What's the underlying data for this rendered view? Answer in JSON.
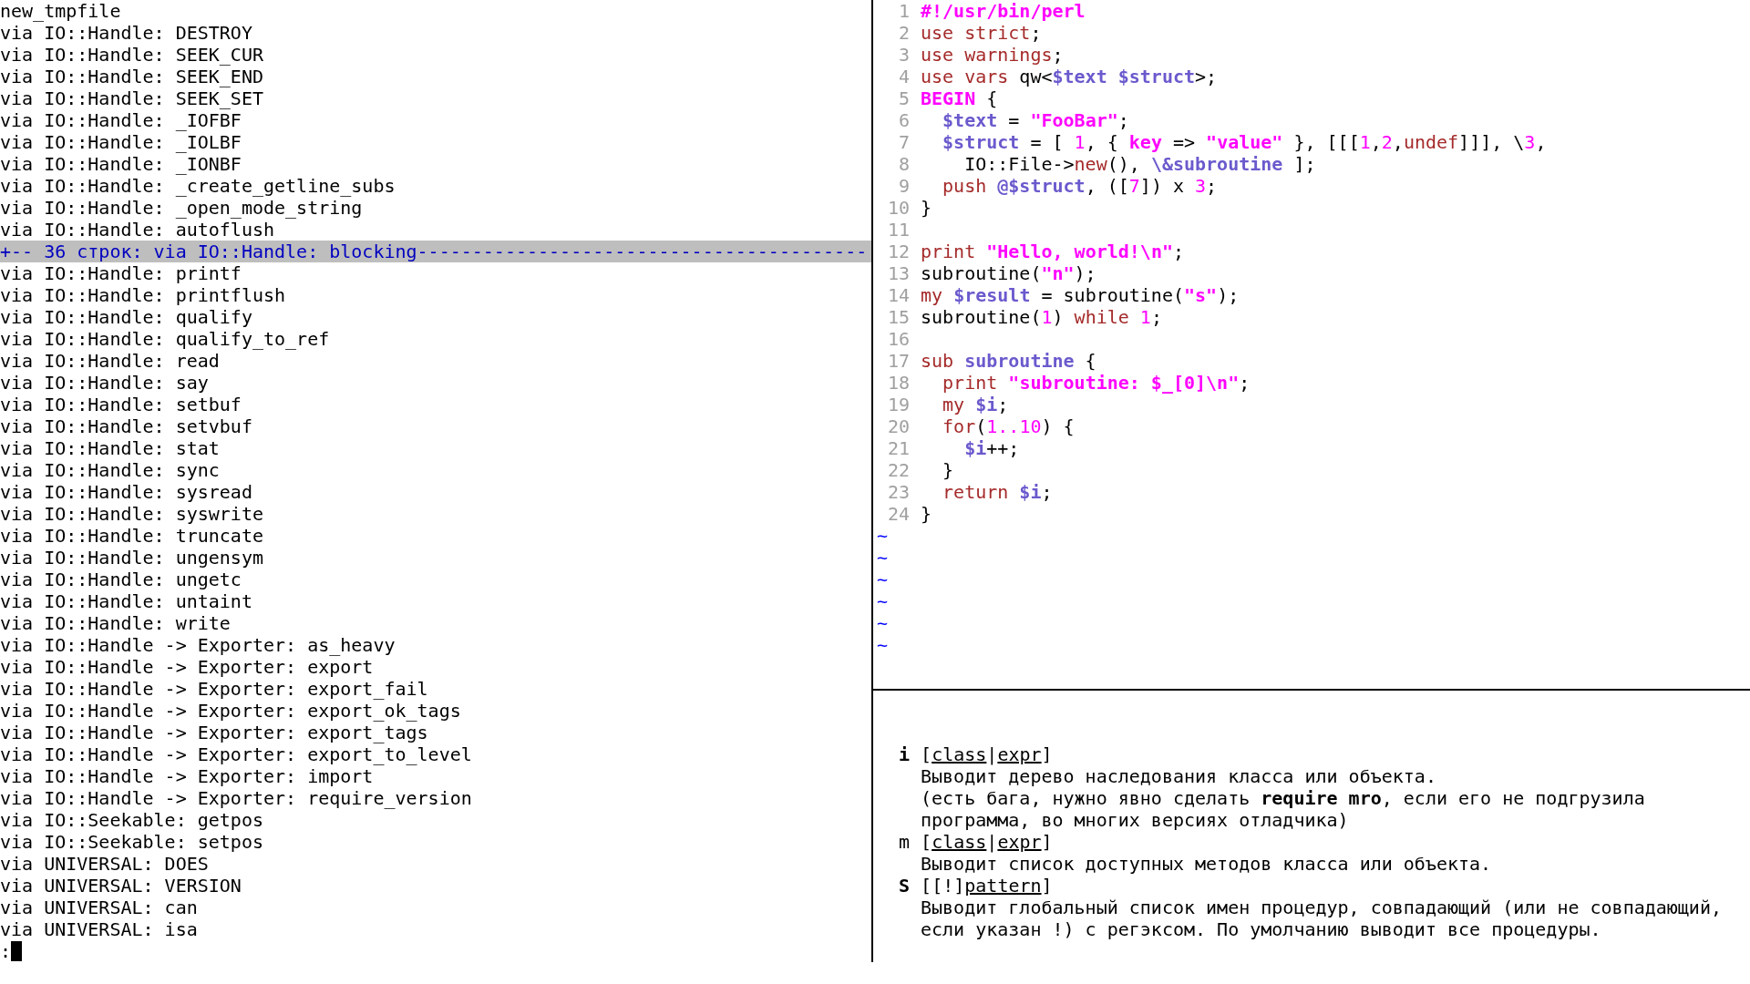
{
  "left_pane": {
    "lines": [
      {
        "kind": "line",
        "text": "new_tmpfile"
      },
      {
        "kind": "line",
        "text": "via IO::Handle: DESTROY"
      },
      {
        "kind": "line",
        "text": "via IO::Handle: SEEK_CUR"
      },
      {
        "kind": "line",
        "text": "via IO::Handle: SEEK_END"
      },
      {
        "kind": "line",
        "text": "via IO::Handle: SEEK_SET"
      },
      {
        "kind": "line",
        "text": "via IO::Handle: _IOFBF"
      },
      {
        "kind": "line",
        "text": "via IO::Handle: _IOLBF"
      },
      {
        "kind": "line",
        "text": "via IO::Handle: _IONBF"
      },
      {
        "kind": "line",
        "text": "via IO::Handle: _create_getline_subs"
      },
      {
        "kind": "line",
        "text": "via IO::Handle: _open_mode_string"
      },
      {
        "kind": "line",
        "text": "via IO::Handle: autoflush"
      },
      {
        "kind": "fold",
        "text": "+-- 36 строк: via IO::Handle: blocking-----------------------------------------"
      },
      {
        "kind": "line",
        "text": "via IO::Handle: printf"
      },
      {
        "kind": "line",
        "text": "via IO::Handle: printflush"
      },
      {
        "kind": "line",
        "text": "via IO::Handle: qualify"
      },
      {
        "kind": "line",
        "text": "via IO::Handle: qualify_to_ref"
      },
      {
        "kind": "line",
        "text": "via IO::Handle: read"
      },
      {
        "kind": "line",
        "text": "via IO::Handle: say"
      },
      {
        "kind": "line",
        "text": "via IO::Handle: setbuf"
      },
      {
        "kind": "line",
        "text": "via IO::Handle: setvbuf"
      },
      {
        "kind": "line",
        "text": "via IO::Handle: stat"
      },
      {
        "kind": "line",
        "text": "via IO::Handle: sync"
      },
      {
        "kind": "line",
        "text": "via IO::Handle: sysread"
      },
      {
        "kind": "line",
        "text": "via IO::Handle: syswrite"
      },
      {
        "kind": "line",
        "text": "via IO::Handle: truncate"
      },
      {
        "kind": "line",
        "text": "via IO::Handle: ungensym"
      },
      {
        "kind": "line",
        "text": "via IO::Handle: ungetc"
      },
      {
        "kind": "line",
        "text": "via IO::Handle: untaint"
      },
      {
        "kind": "line",
        "text": "via IO::Handle: write"
      },
      {
        "kind": "line",
        "text": "via IO::Handle -> Exporter: as_heavy"
      },
      {
        "kind": "line",
        "text": "via IO::Handle -> Exporter: export"
      },
      {
        "kind": "line",
        "text": "via IO::Handle -> Exporter: export_fail"
      },
      {
        "kind": "line",
        "text": "via IO::Handle -> Exporter: export_ok_tags"
      },
      {
        "kind": "line",
        "text": "via IO::Handle -> Exporter: export_tags"
      },
      {
        "kind": "line",
        "text": "via IO::Handle -> Exporter: export_to_level"
      },
      {
        "kind": "line",
        "text": "via IO::Handle -> Exporter: import"
      },
      {
        "kind": "line",
        "text": "via IO::Handle -> Exporter: require_version"
      },
      {
        "kind": "line",
        "text": "via IO::Seekable: getpos"
      },
      {
        "kind": "line",
        "text": "via IO::Seekable: setpos"
      },
      {
        "kind": "line",
        "text": "via UNIVERSAL: DOES"
      },
      {
        "kind": "line",
        "text": "via UNIVERSAL: VERSION"
      },
      {
        "kind": "line",
        "text": "via UNIVERSAL: can"
      },
      {
        "kind": "line",
        "text": "via UNIVERSAL: isa"
      }
    ],
    "command_line": {
      "prompt": ":"
    }
  },
  "editor": {
    "lines": [
      {
        "number": "1",
        "segments": [
          {
            "kind": "preproc",
            "text": "#!/usr/bin/perl"
          }
        ]
      },
      {
        "number": "2",
        "segments": [
          {
            "kind": "keyword",
            "text": "use strict"
          },
          {
            "kind": "plain",
            "text": ";"
          }
        ]
      },
      {
        "number": "3",
        "segments": [
          {
            "kind": "keyword",
            "text": "use warnings"
          },
          {
            "kind": "plain",
            "text": ";"
          }
        ]
      },
      {
        "number": "4",
        "segments": [
          {
            "kind": "keyword",
            "text": "use vars"
          },
          {
            "kind": "plain",
            "text": " qw<"
          },
          {
            "kind": "variable",
            "text": "$text $struct"
          },
          {
            "kind": "plain",
            "text": ">;"
          }
        ]
      },
      {
        "number": "5",
        "segments": [
          {
            "kind": "preproc",
            "text": "BEGIN"
          },
          {
            "kind": "plain",
            "text": " {"
          }
        ]
      },
      {
        "number": "6",
        "segments": [
          {
            "kind": "variable",
            "text": "  $text"
          },
          {
            "kind": "plain",
            "text": " = "
          },
          {
            "kind": "string",
            "text": "\"FooBar\""
          },
          {
            "kind": "plain",
            "text": ";"
          }
        ]
      },
      {
        "number": "7",
        "segments": [
          {
            "kind": "variable",
            "text": "  $struct"
          },
          {
            "kind": "plain",
            "text": " = [ "
          },
          {
            "kind": "number",
            "text": "1"
          },
          {
            "kind": "plain",
            "text": ", { "
          },
          {
            "kind": "string",
            "text": "key"
          },
          {
            "kind": "plain",
            "text": " => "
          },
          {
            "kind": "string",
            "text": "\"value\""
          },
          {
            "kind": "plain",
            "text": " }, [[["
          },
          {
            "kind": "number",
            "text": "1"
          },
          {
            "kind": "plain",
            "text": ","
          },
          {
            "kind": "number",
            "text": "2"
          },
          {
            "kind": "plain",
            "text": ","
          },
          {
            "kind": "keyword",
            "text": "undef"
          },
          {
            "kind": "plain",
            "text": "]]], \\"
          },
          {
            "kind": "number",
            "text": "3"
          },
          {
            "kind": "plain",
            "text": ","
          }
        ]
      },
      {
        "number": "8",
        "segments": [
          {
            "kind": "plain",
            "text": "    IO::File->"
          },
          {
            "kind": "keyword",
            "text": "new"
          },
          {
            "kind": "plain",
            "text": "(), "
          },
          {
            "kind": "variable",
            "text": "\\&subroutine"
          },
          {
            "kind": "plain",
            "text": " ];"
          }
        ]
      },
      {
        "number": "9",
        "segments": [
          {
            "kind": "keyword",
            "text": "  push"
          },
          {
            "kind": "variable",
            "text": " @$struct"
          },
          {
            "kind": "plain",
            "text": ", (["
          },
          {
            "kind": "number",
            "text": "7"
          },
          {
            "kind": "plain",
            "text": "]) x "
          },
          {
            "kind": "number",
            "text": "3"
          },
          {
            "kind": "plain",
            "text": ";"
          }
        ]
      },
      {
        "number": "10",
        "segments": [
          {
            "kind": "plain",
            "text": "}"
          }
        ]
      },
      {
        "number": "11"
      },
      {
        "number": "12",
        "segments": [
          {
            "kind": "keyword",
            "text": "print"
          },
          {
            "kind": "string",
            "text": " \"Hello, world!\\n\""
          },
          {
            "kind": "plain",
            "text": ";"
          }
        ]
      },
      {
        "number": "13",
        "segments": [
          {
            "kind": "plain",
            "text": "subroutine("
          },
          {
            "kind": "string",
            "text": "\"n\""
          },
          {
            "kind": "plain",
            "text": ");"
          }
        ]
      },
      {
        "number": "14",
        "segments": [
          {
            "kind": "keyword",
            "text": "my"
          },
          {
            "kind": "variable",
            "text": " $result"
          },
          {
            "kind": "plain",
            "text": " = subroutine("
          },
          {
            "kind": "string",
            "text": "\"s\""
          },
          {
            "kind": "plain",
            "text": ");"
          }
        ]
      },
      {
        "number": "15",
        "segments": [
          {
            "kind": "plain",
            "text": "subroutine("
          },
          {
            "kind": "number",
            "text": "1"
          },
          {
            "kind": "plain",
            "text": ") "
          },
          {
            "kind": "keyword",
            "text": "while"
          },
          {
            "kind": "number",
            "text": " 1"
          },
          {
            "kind": "plain",
            "text": ";"
          }
        ]
      },
      {
        "number": "16"
      },
      {
        "number": "17",
        "segments": [
          {
            "kind": "keyword",
            "text": "sub"
          },
          {
            "kind": "variable",
            "text": " subroutine"
          },
          {
            "kind": "plain",
            "text": " {"
          }
        ]
      },
      {
        "number": "18",
        "segments": [
          {
            "kind": "keyword",
            "text": "  print"
          },
          {
            "kind": "string",
            "text": " \"subroutine: $_[0]\\n\""
          },
          {
            "kind": "plain",
            "text": ";"
          }
        ]
      },
      {
        "number": "19",
        "segments": [
          {
            "kind": "keyword",
            "text": "  my"
          },
          {
            "kind": "variable",
            "text": " $i"
          },
          {
            "kind": "plain",
            "text": ";"
          }
        ]
      },
      {
        "number": "20",
        "segments": [
          {
            "kind": "keyword",
            "text": "  for"
          },
          {
            "kind": "plain",
            "text": "("
          },
          {
            "kind": "number",
            "text": "1..10"
          },
          {
            "kind": "plain",
            "text": ") {"
          }
        ]
      },
      {
        "number": "21",
        "segments": [
          {
            "kind": "variable",
            "text": "    $i"
          },
          {
            "kind": "plain",
            "text": "++;"
          }
        ]
      },
      {
        "number": "22",
        "segments": [
          {
            "kind": "plain",
            "text": "  }"
          }
        ]
      },
      {
        "number": "23",
        "segments": [
          {
            "kind": "keyword",
            "text": "  return"
          },
          {
            "kind": "variable",
            "text": " $i"
          },
          {
            "kind": "plain",
            "text": ";"
          }
        ]
      },
      {
        "number": "24",
        "segments": [
          {
            "kind": "plain",
            "text": "}"
          }
        ]
      }
    ],
    "empty_line_markers": [
      "~",
      "~",
      "~",
      "~",
      "~",
      "~"
    ]
  },
  "help": {
    "entries": [
      {
        "key": "i",
        "bold": true,
        "args": [
          {
            "kind": "plain",
            "text": "["
          },
          {
            "kind": "param",
            "text": "class"
          },
          {
            "kind": "plain",
            "text": "|"
          },
          {
            "kind": "param",
            "text": "expr"
          },
          {
            "kind": "plain",
            "text": "]"
          }
        ],
        "description": [
          "Выводит дерево наследования класса или объекта.",
          "(есть бага, нужно явно сделать **require mro**, если его не подгрузила",
          "программа, во многих версиях отладчика)"
        ]
      },
      {
        "key": "m",
        "bold": false,
        "args": [
          {
            "kind": "plain",
            "text": "["
          },
          {
            "kind": "param",
            "text": "class"
          },
          {
            "kind": "plain",
            "text": "|"
          },
          {
            "kind": "param",
            "text": "expr"
          },
          {
            "kind": "plain",
            "text": "]"
          }
        ],
        "description": [
          "Выводит список доступных методов класса или объекта."
        ]
      },
      {
        "key": "S",
        "bold": true,
        "args": [
          {
            "kind": "plain",
            "text": "[[!]"
          },
          {
            "kind": "param",
            "text": "pattern"
          },
          {
            "kind": "plain",
            "text": "]"
          }
        ],
        "description": [
          "Выводит глобальный список имен процедур, совпадающий (или не совпадающий,",
          "если указан !) с регэксом. По умолчанию выводит все процедуры."
        ]
      }
    ]
  }
}
